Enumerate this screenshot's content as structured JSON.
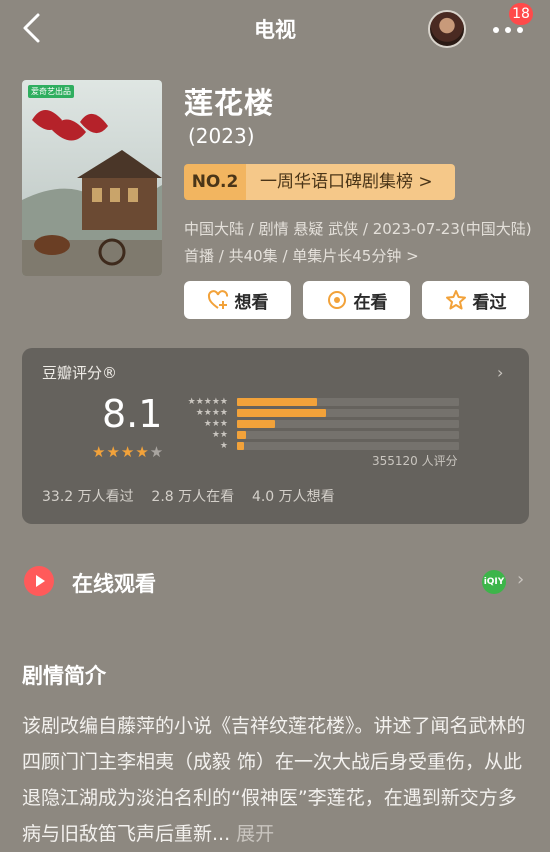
{
  "header": {
    "title": "电视",
    "notification_count": "18"
  },
  "show": {
    "title": "莲花楼",
    "year": "(2023)",
    "rank_no": "NO.2",
    "rank_text": "一周华语口碑剧集榜 >",
    "meta": "中国大陆 / 剧情 悬疑 武侠 / 2023-07-23(中国大陆) 首播 / 共40集 / 单集片长45分钟 >",
    "poster_tag": "爱奇艺出品"
  },
  "actions": {
    "want": "想看",
    "watching": "在看",
    "watched": "看过"
  },
  "rating": {
    "label": "豆瓣评分®",
    "score": "8.1",
    "stars": "★★★★",
    "star_empty": "★",
    "raters": "355120 人评分",
    "distribution": [
      0.36,
      0.4,
      0.17,
      0.04,
      0.03
    ],
    "stats": "33.2 万人看过    2.8 万人在看    4.0 万人想看"
  },
  "watch_online": {
    "label": "在线观看",
    "platform": "iQIY"
  },
  "summary": {
    "title": "剧情简介",
    "text": "该剧改编自藤萍的小说《吉祥纹莲花楼》。讲述了闻名武林的四顾门门主李相夷（成毅 饰）在一次大战后身受重伤，从此退隐江湖成为淡泊名利的“假神医”李莲花，在遇到新交方多病与旧敌笛飞声后重新...",
    "expand": "展开"
  },
  "colors": {
    "background": "#8d8880",
    "accent_orange": "#f2a23a",
    "badge_red": "#ff4a4a"
  }
}
